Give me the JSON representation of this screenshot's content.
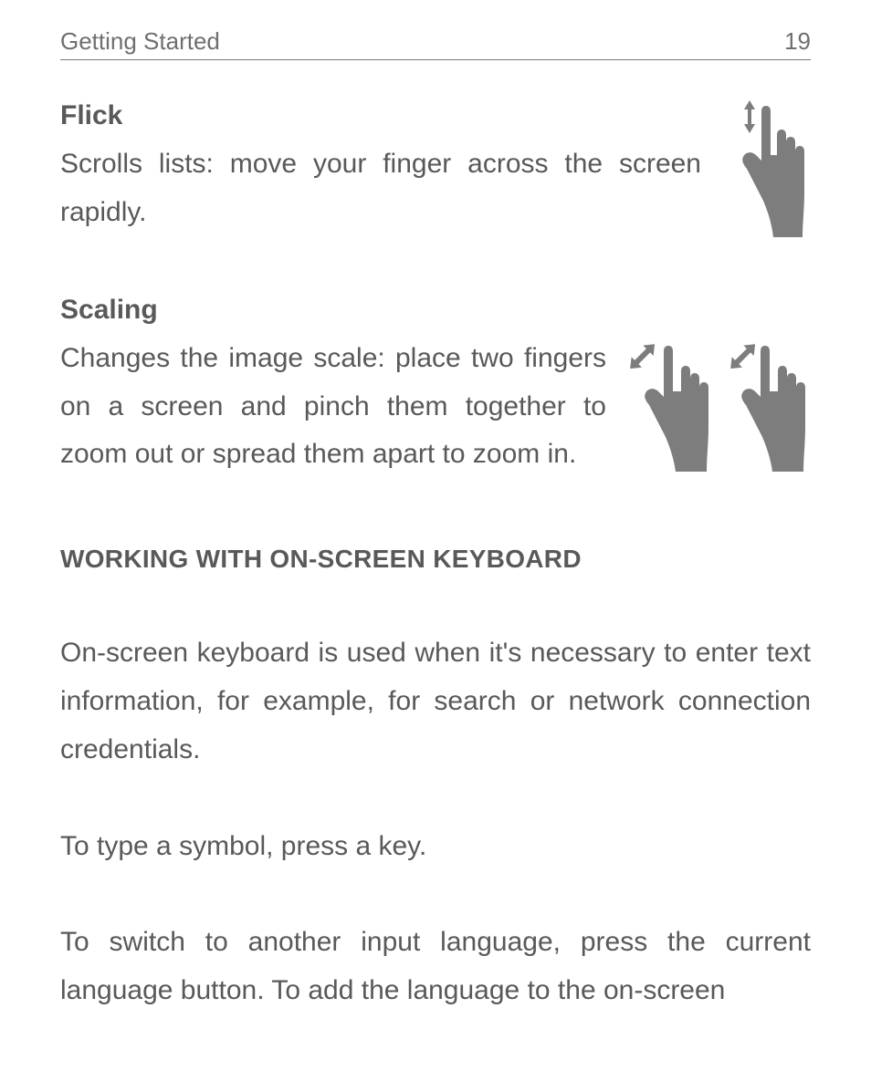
{
  "running_head": {
    "title": "Getting Started",
    "page_number": "19"
  },
  "gestures": {
    "flick": {
      "heading": "Flick",
      "body": "Scrolls lists: move your finger across the screen rapidly."
    },
    "scaling": {
      "heading": "Scaling",
      "body": "Changes the image scale: place two fingers on a screen and pinch them together to zoom out or spread them apart to zoom in."
    }
  },
  "section_title": "WORKING WITH ON-SCREEN KEYBOARD",
  "paragraphs": {
    "p1": "On-screen keyboard is used when it's necessary to enter text information, for example, for search or network connection credentials.",
    "p2": "To type a symbol, press a key.",
    "p3": "To switch to another input language, press the current language button. To add the language to the on-screen"
  },
  "icons": {
    "flick": "flick-hand-icon",
    "scaling": "pinch-hands-icon"
  }
}
